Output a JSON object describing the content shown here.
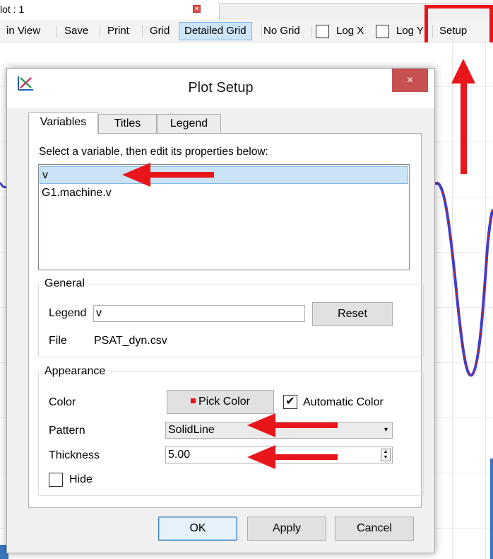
{
  "background_window": {
    "tab_title": "lot : 1",
    "toolbar": {
      "items": [
        "in View",
        "Save",
        "Print",
        "Grid",
        "Detailed Grid",
        "No Grid"
      ],
      "log_x": "Log X",
      "log_y": "Log Y",
      "setup": "Setup",
      "active_item": "Detailed Grid"
    }
  },
  "dialog": {
    "title": "Plot Setup",
    "close_symbol": "×",
    "tabs": [
      "Variables",
      "Titles",
      "Legend"
    ],
    "active_tab": "Variables",
    "instruction": "Select a variable, then edit its properties below:",
    "variables": [
      "v",
      "G1.machine.v"
    ],
    "selected_variable": "v",
    "general": {
      "title": "General",
      "legend_label": "Legend",
      "legend_value": "v",
      "reset_button": "Reset",
      "file_label": "File",
      "file_value": "PSAT_dyn.csv"
    },
    "appearance": {
      "title": "Appearance",
      "color_label": "Color",
      "pick_color_button": "Pick Color",
      "pick_color_swatch": "#e8151a",
      "automatic_color_label": "Automatic Color",
      "automatic_color_checked": true,
      "pattern_label": "Pattern",
      "pattern_value": "SolidLine",
      "thickness_label": "Thickness",
      "thickness_value": "5.00",
      "hide_label": "Hide",
      "hide_checked": false
    },
    "buttons": {
      "ok": "OK",
      "apply": "Apply",
      "cancel": "Cancel"
    }
  },
  "colors": {
    "annotation_red": "#e8151a",
    "curve_blue": "#3b3fd0",
    "curve_red": "#d02020",
    "selection_blue": "#cbe4f5"
  },
  "icons": [
    "plot-setup-icon",
    "close-icon",
    "checkmark-icon",
    "dropdown-arrow-icon",
    "spin-arrows-icon",
    "annotation-arrow-icon"
  ]
}
